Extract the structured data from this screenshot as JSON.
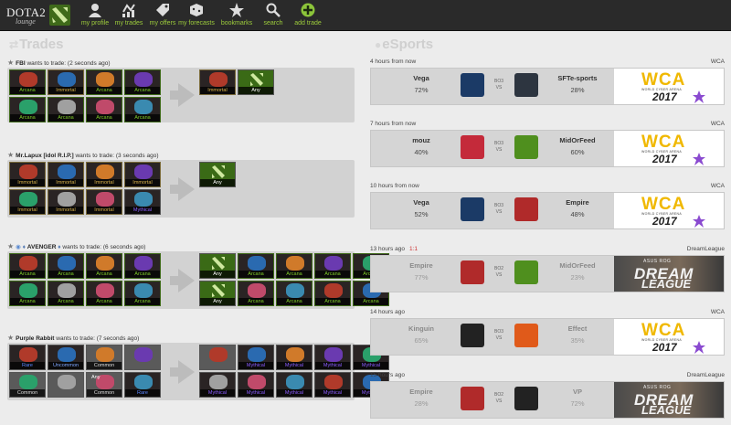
{
  "header": {
    "logo_title": "DOTA2",
    "logo_sub": "lounge",
    "nav": [
      {
        "label": "my profile",
        "icon": "profile-icon"
      },
      {
        "label": "my trades",
        "icon": "trades-icon"
      },
      {
        "label": "my offers",
        "icon": "offers-icon"
      },
      {
        "label": "my forecasts",
        "icon": "forecasts-icon"
      },
      {
        "label": "bookmarks",
        "icon": "star-icon"
      },
      {
        "label": "search",
        "icon": "search-icon"
      },
      {
        "label": "add trade",
        "icon": "plus-icon"
      }
    ]
  },
  "sections": {
    "trades": "Trades",
    "esports": "eSports"
  },
  "trades": [
    {
      "user": "FBI",
      "text": "wants to trade: (2 seconds ago)",
      "offer": [
        {
          "rarity": "Arcana",
          "color": "#7fcc2a"
        },
        {
          "rarity": "Immortal",
          "color": "#d8b14a"
        },
        {
          "rarity": "Arcana",
          "color": "#7fcc2a"
        },
        {
          "rarity": "Arcana",
          "color": "#7fcc2a"
        },
        {
          "rarity": "Arcana",
          "color": "#7fcc2a"
        },
        {
          "rarity": "Arcana",
          "color": "#7fcc2a"
        },
        {
          "rarity": "Arcana",
          "color": "#7fcc2a"
        },
        {
          "rarity": "Arcana",
          "color": "#7fcc2a"
        }
      ],
      "want": [
        {
          "rarity": "Immortal",
          "color": "#d8b14a"
        },
        {
          "rarity": "Any",
          "color": "#ffffff"
        }
      ]
    },
    {
      "user": "Mr.Lapux [idol R.I.P.]",
      "text": "wants to trade: (3 seconds ago)",
      "offer": [
        {
          "rarity": "Immortal",
          "color": "#d8b14a"
        },
        {
          "rarity": "Immortal",
          "color": "#d8b14a"
        },
        {
          "rarity": "Immortal",
          "color": "#d8b14a"
        },
        {
          "rarity": "Immortal",
          "color": "#d8b14a"
        },
        {
          "rarity": "Immortal",
          "color": "#d8b14a"
        },
        {
          "rarity": "Immortal",
          "color": "#d8b14a"
        },
        {
          "rarity": "Immortal",
          "color": "#d8b14a"
        },
        {
          "rarity": "Mythical",
          "color": "#8a5cff"
        }
      ],
      "want": [
        {
          "rarity": "Any",
          "color": "#ffffff"
        }
      ]
    },
    {
      "user": "AVENGER",
      "text": "wants to trade: (6 seconds ago)",
      "offer": [
        {
          "rarity": "Arcana",
          "color": "#7fcc2a"
        },
        {
          "rarity": "Arcana",
          "color": "#7fcc2a"
        },
        {
          "rarity": "Arcana",
          "color": "#7fcc2a"
        },
        {
          "rarity": "Arcana",
          "color": "#7fcc2a"
        },
        {
          "rarity": "Arcana",
          "color": "#7fcc2a"
        },
        {
          "rarity": "Arcana",
          "color": "#7fcc2a"
        },
        {
          "rarity": "Arcana",
          "color": "#7fcc2a"
        },
        {
          "rarity": "Arcana",
          "color": "#7fcc2a"
        }
      ],
      "want": [
        {
          "rarity": "Any",
          "color": "#ffffff"
        },
        {
          "rarity": "Arcana",
          "color": "#7fcc2a"
        },
        {
          "rarity": "Arcana",
          "color": "#7fcc2a"
        },
        {
          "rarity": "Arcana",
          "color": "#7fcc2a"
        },
        {
          "rarity": "Arcana",
          "color": "#7fcc2a"
        },
        {
          "rarity": "Any",
          "color": "#ffffff"
        },
        {
          "rarity": "Arcana",
          "color": "#7fcc2a"
        },
        {
          "rarity": "Arcana",
          "color": "#7fcc2a"
        },
        {
          "rarity": "Arcana",
          "color": "#7fcc2a"
        },
        {
          "rarity": "Arcana",
          "color": "#7fcc2a"
        }
      ]
    },
    {
      "user": "Purple Rabbit",
      "text": "wants to trade: (7 seconds ago)",
      "offer": [
        {
          "rarity": "Rare",
          "color": "#5b86ff"
        },
        {
          "rarity": "Uncommon",
          "color": "#7ea6ff"
        },
        {
          "rarity": "Common",
          "color": "#dddddd"
        },
        {
          "rarity": "",
          "color": "#dddddd"
        },
        {
          "rarity": "Common",
          "color": "#dddddd"
        },
        {
          "rarity": "",
          "color": "#dddddd"
        },
        {
          "rarity": "Common",
          "color": "#dddddd"
        },
        {
          "rarity": "Rare",
          "color": "#5b86ff"
        }
      ],
      "want": [
        {
          "rarity": "",
          "color": "#dddddd"
        },
        {
          "rarity": "Mythical",
          "color": "#8a5cff"
        },
        {
          "rarity": "Mythical",
          "color": "#8a5cff"
        },
        {
          "rarity": "Mythical",
          "color": "#8a5cff"
        },
        {
          "rarity": "Mythical",
          "color": "#8a5cff"
        },
        {
          "rarity": "Mythical",
          "color": "#8a5cff"
        },
        {
          "rarity": "Mythical",
          "color": "#8a5cff"
        },
        {
          "rarity": "Mythical",
          "color": "#8a5cff"
        },
        {
          "rarity": "Mythical",
          "color": "#8a5cff"
        },
        {
          "rarity": "Mythical",
          "color": "#8a5cff"
        }
      ],
      "overlay_any": "Any"
    }
  ],
  "matches": [
    {
      "time": "4 hours from now",
      "live": "",
      "event": "WCA",
      "team1": "Vega",
      "pct1": "72%",
      "team2": "SFTe-sports",
      "pct2": "28%",
      "bo": "BO3",
      "vs": "VS",
      "banner": "wca",
      "t1color": "#1b3a66",
      "t2color": "#2d3540"
    },
    {
      "time": "7 hours from now",
      "live": "",
      "event": "WCA",
      "team1": "mouz",
      "pct1": "40%",
      "team2": "MidOrFeed",
      "pct2": "60%",
      "bo": "BO3",
      "vs": "VS",
      "banner": "wca",
      "t1color": "#c42a3a",
      "t2color": "#4f8f1e"
    },
    {
      "time": "10 hours from now",
      "live": "",
      "event": "WCA",
      "team1": "Vega",
      "pct1": "52%",
      "team2": "Empire",
      "pct2": "48%",
      "bo": "BO3",
      "vs": "VS",
      "banner": "wca",
      "t1color": "#1b3a66",
      "t2color": "#b02a2a"
    },
    {
      "time": "13 hours ago",
      "live": "1:1",
      "event": "DreamLeague",
      "team1": "Empire",
      "pct1": "77%",
      "team2": "MidOrFeed",
      "pct2": "23%",
      "bo": "BO2",
      "vs": "VS",
      "banner": "dream",
      "t1color": "#b02a2a",
      "t2color": "#4f8f1e"
    },
    {
      "time": "14 hours ago",
      "live": "",
      "event": "WCA",
      "team1": "Kinguin",
      "pct1": "65%",
      "team2": "Effect",
      "pct2": "35%",
      "bo": "BO3",
      "vs": "VS",
      "banner": "wca",
      "t1color": "#222222",
      "t2color": "#e05a1a"
    },
    {
      "time": "15 hours ago",
      "live": "",
      "event": "DreamLeague",
      "team1": "Empire",
      "pct1": "28%",
      "team2": "VP",
      "pct2": "72%",
      "bo": "BO2",
      "vs": "VS",
      "banner": "dream",
      "t1color": "#b02a2a",
      "t2color": "#222222"
    }
  ],
  "banners": {
    "wca_name": "WCA",
    "wca_sub": "WORLD CYBER ARENA",
    "wca_year": "2017",
    "dl_top": "ASUS ROG",
    "dl_mid": "DREAM",
    "dl_bot": "LEAGUE"
  }
}
